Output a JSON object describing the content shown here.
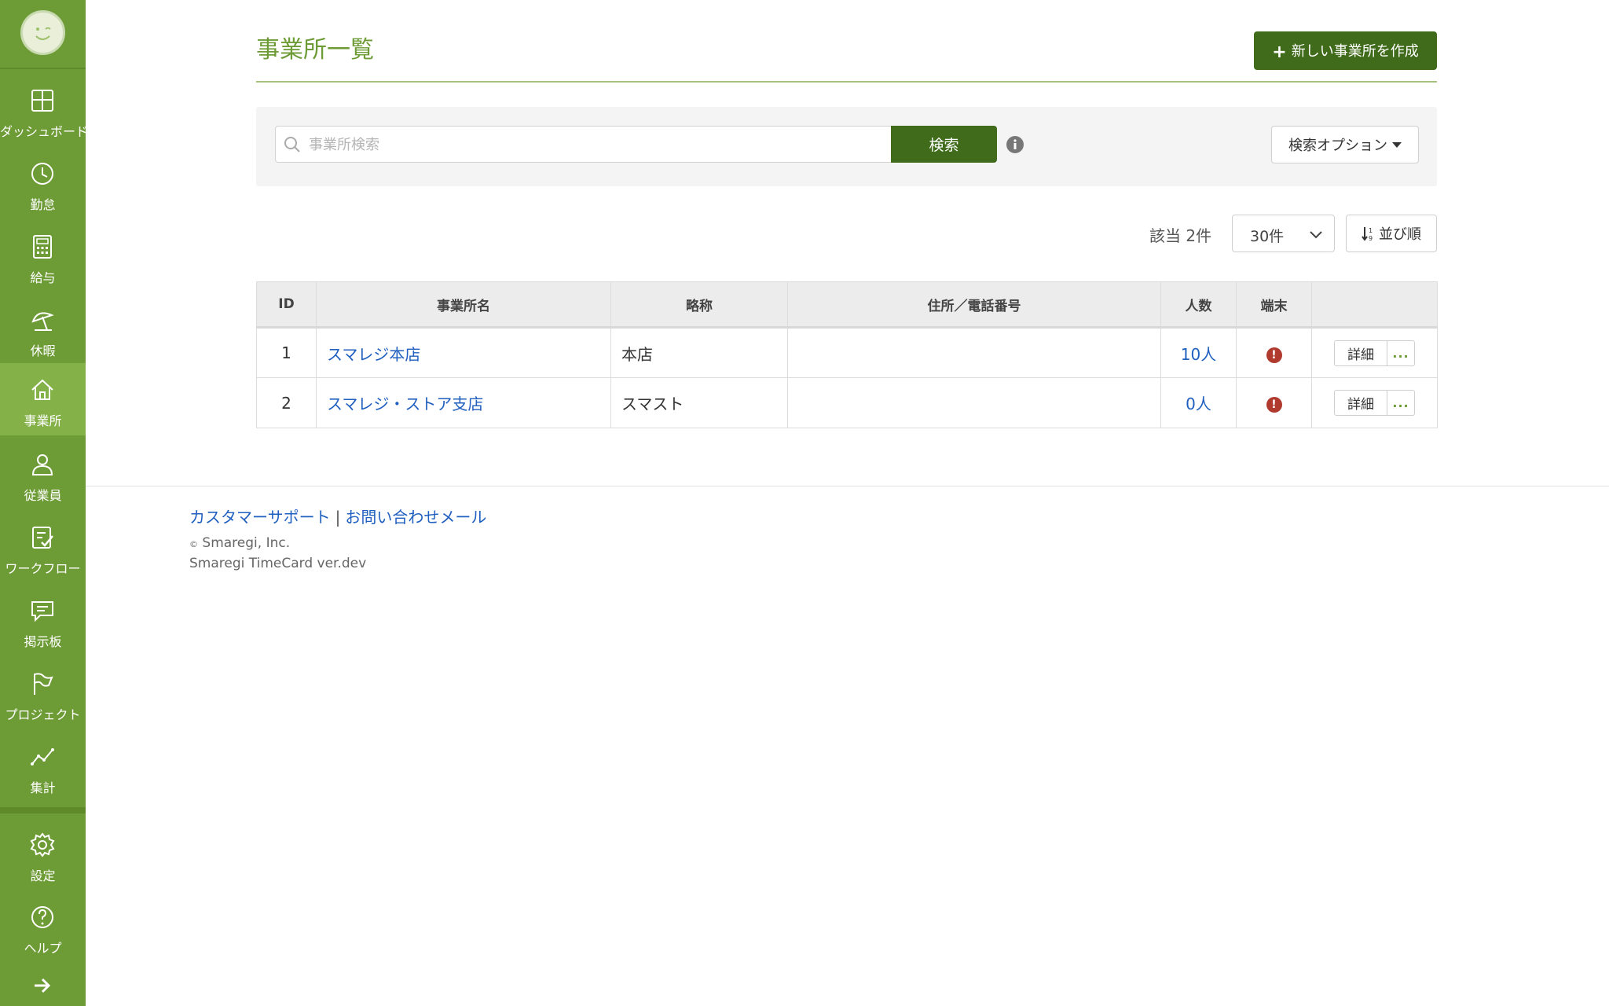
{
  "sidebar": {
    "items": [
      {
        "label": "ダッシュボード",
        "icon": "dashboard-icon",
        "active": false
      },
      {
        "label": "勤怠",
        "icon": "clock-icon",
        "active": false
      },
      {
        "label": "給与",
        "icon": "calculator-icon",
        "active": false
      },
      {
        "label": "休暇",
        "icon": "beach-umbrella-icon",
        "active": false
      },
      {
        "label": "事業所",
        "icon": "home-icon",
        "active": true
      },
      {
        "label": "従業員",
        "icon": "person-icon",
        "active": false
      },
      {
        "label": "ワークフロー",
        "icon": "checklist-icon",
        "active": false
      },
      {
        "label": "掲示板",
        "icon": "message-icon",
        "active": false
      },
      {
        "label": "プロジェクト",
        "icon": "flag-icon",
        "active": false
      },
      {
        "label": "集計",
        "icon": "line-chart-icon",
        "active": false
      }
    ],
    "bottom_items": [
      {
        "label": "設定",
        "icon": "gear-icon"
      },
      {
        "label": "ヘルプ",
        "icon": "help-icon"
      }
    ],
    "colors": {
      "bg": "#6d9b35",
      "active": "#84b148"
    }
  },
  "header": {
    "title": "事業所一覧",
    "new_button_label": "新しい事業所を作成"
  },
  "search": {
    "placeholder": "事業所検索",
    "value": "",
    "button_label": "検索",
    "options_label": "検索オプション"
  },
  "results": {
    "count_label": "該当 2件",
    "per_page": "30件",
    "sort_label": "並び順"
  },
  "table": {
    "headers": [
      "ID",
      "事業所名",
      "略称",
      "住所／電話番号",
      "人数",
      "端末",
      ""
    ],
    "rows": [
      {
        "id": "1",
        "name": "スマレジ本店",
        "abbr": "本店",
        "address": "",
        "count": "10人",
        "terminal": "!",
        "detail": "詳細",
        "more": "..."
      },
      {
        "id": "2",
        "name": "スマレジ・ストア支店",
        "abbr": "スマスト",
        "address": "",
        "count": "0人",
        "terminal": "!",
        "detail": "詳細",
        "more": "..."
      }
    ]
  },
  "footer": {
    "support_link": "カスタマーサポート",
    "separator": "|",
    "mail_link": "お問い合わせメール",
    "copyright_mark": "©",
    "copyright": "Smaregi, Inc.",
    "version": "Smaregi TimeCard ver.dev"
  },
  "colors": {
    "accent": "#6d9b35",
    "button_dark": "#3f6b1a",
    "link": "#1f5fbf",
    "alert": "#b03a2e"
  }
}
